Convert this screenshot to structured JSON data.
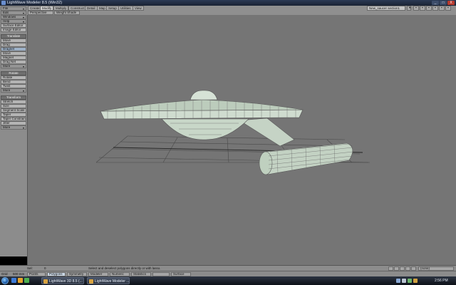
{
  "window": {
    "title": "LightWave Modeler 8.5 (Win32)",
    "buttons": [
      "_",
      "□",
      "X"
    ]
  },
  "tabs": [
    {
      "label": "Create",
      "active": false
    },
    {
      "label": "Modify",
      "active": true
    },
    {
      "label": "Multiply",
      "active": false
    },
    {
      "label": "Construct",
      "active": false
    },
    {
      "label": "Detail",
      "active": false
    },
    {
      "label": "Map",
      "active": false
    },
    {
      "label": "Setup",
      "active": false
    },
    {
      "label": "Utilities",
      "active": false
    },
    {
      "label": "View",
      "active": false
    }
  ],
  "object_selector": "New_saucer section1",
  "viewport_header": {
    "view": "Perspective",
    "shade": "Weight Shade"
  },
  "toolbar": {
    "top_menus": [
      "File",
      "Edit",
      "Windows",
      "Help",
      "Surface Editor",
      "Image Editor"
    ],
    "translate_header": "Translate",
    "translate_items": [
      "Move",
      "Drag",
      "Dragnet",
      "Move",
      "Magnet",
      "Drag Net"
    ],
    "translate_more": "More",
    "rotate_header": "Rotate",
    "rotate_items": [
      "Rotate",
      "Bend",
      "Twist"
    ],
    "rotate_more": "More",
    "transform_header": "Transform",
    "transform_items": [
      "Stretch",
      "Size",
      "Segment Scale",
      "Taper",
      "Taper Constrain",
      "Jitter"
    ],
    "transform_more": "More"
  },
  "status": {
    "sel_label": "Sel:",
    "sel_value": "0",
    "hint": "Select and deselect polygons directly or with lasso.",
    "render_mode": "(none)",
    "grid_label": "Grid",
    "grid_value": "500 mm",
    "points_btn": "Points",
    "polygons_btn": "Polygons",
    "symmetry_btn": "Symmetry",
    "mode_btn": "Modeler",
    "numeric_btn": "Numeric",
    "statistics_btn": "Statistics",
    "surface_btn": "Surface"
  },
  "taskbar": {
    "items": [
      "LightWave 3D 8.5 (...",
      "LightWave Modeler ..."
    ],
    "clock": "2:56 PM"
  },
  "colors": {
    "viewport_bg": "#757575",
    "mesh_fill": "#bfcfbf",
    "wire": "#5a5a5a",
    "grid": "#4d4d4d"
  }
}
